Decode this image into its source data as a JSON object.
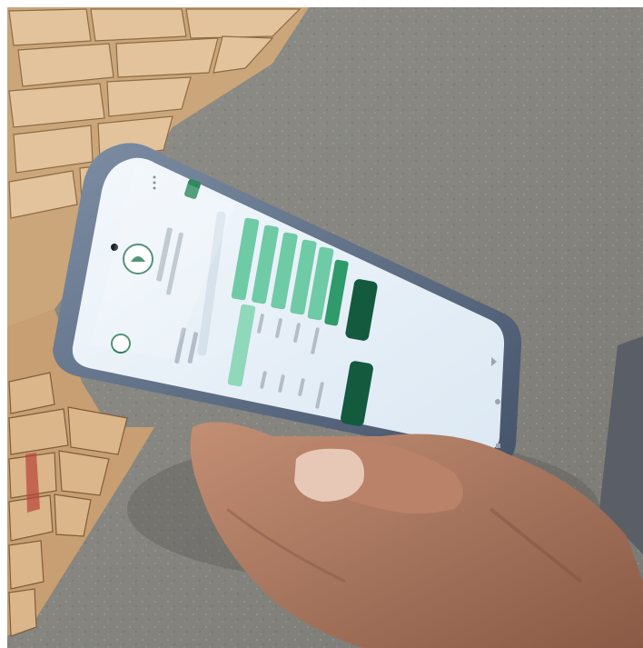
{
  "scene": {
    "palette": {
      "ground": "#8b8a86",
      "ground_dark": "#6f6e6a",
      "lumber": "#d8b58a",
      "lumber_dark": "#9c7a52",
      "phone_frame": "#5d6f86",
      "screen": "#e9f1f8",
      "app_green": "#5fbf9a",
      "app_dark_green": "#135a3f",
      "skin": "#b07d64",
      "skin_dark": "#7a4e3c",
      "fabric": "#5a5e66"
    },
    "phone_app": {
      "icons": [
        "logo-icon",
        "menu-dots-icon",
        "back-icon",
        "home-icon",
        "recent-apps-icon"
      ]
    }
  }
}
